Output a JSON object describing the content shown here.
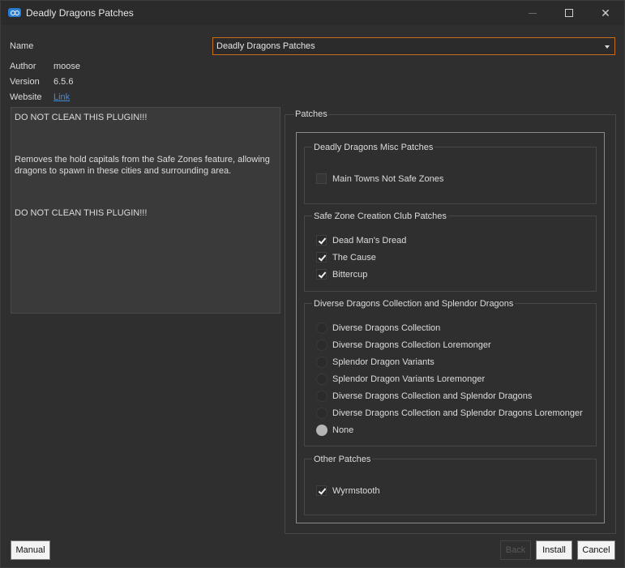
{
  "window": {
    "title": "Deadly Dragons Patches"
  },
  "fields": {
    "name_label": "Name",
    "name_value": "Deadly Dragons Patches",
    "author_label": "Author",
    "author_value": "moose",
    "version_label": "Version",
    "version_value": "6.5.6",
    "website_label": "Website",
    "website_link": "Link"
  },
  "description": {
    "line1": "DO NOT CLEAN THIS PLUGIN!!!",
    "line2": "Removes the hold capitals from the Safe Zones feature, allowing dragons to spawn in these cities and surrounding area.",
    "line3": "DO NOT CLEAN THIS PLUGIN!!!"
  },
  "patches": {
    "title": "Patches",
    "groups": [
      {
        "title": "Deadly Dragons Misc Patches",
        "type": "checkbox",
        "items": [
          {
            "label": "Main Towns Not Safe Zones",
            "checked": false
          }
        ]
      },
      {
        "title": "Safe Zone Creation Club Patches",
        "type": "checkbox",
        "items": [
          {
            "label": "Dead Man's Dread",
            "checked": true
          },
          {
            "label": "The Cause",
            "checked": true
          },
          {
            "label": "Bittercup",
            "checked": true
          }
        ]
      },
      {
        "title": "Diverse Dragons Collection and Splendor Dragons",
        "type": "radio",
        "items": [
          {
            "label": "Diverse Dragons Collection",
            "checked": false
          },
          {
            "label": "Diverse Dragons Collection Loremonger",
            "checked": false
          },
          {
            "label": "Splendor Dragon Variants",
            "checked": false
          },
          {
            "label": "Splendor Dragon Variants Loremonger",
            "checked": false
          },
          {
            "label": "Diverse Dragons Collection and Splendor Dragons",
            "checked": false
          },
          {
            "label": "Diverse Dragons Collection and Splendor Dragons Loremonger",
            "checked": false
          },
          {
            "label": "None",
            "checked": true
          }
        ]
      },
      {
        "title": "Other Patches",
        "type": "checkbox",
        "items": [
          {
            "label": "Wyrmstooth",
            "checked": true
          }
        ]
      }
    ]
  },
  "buttons": {
    "manual": "Manual",
    "back": "Back",
    "install": "Install",
    "cancel": "Cancel"
  },
  "colors": {
    "accent_border": "#c56f1c",
    "link": "#3d8fe0",
    "background": "#2f2f2f"
  }
}
